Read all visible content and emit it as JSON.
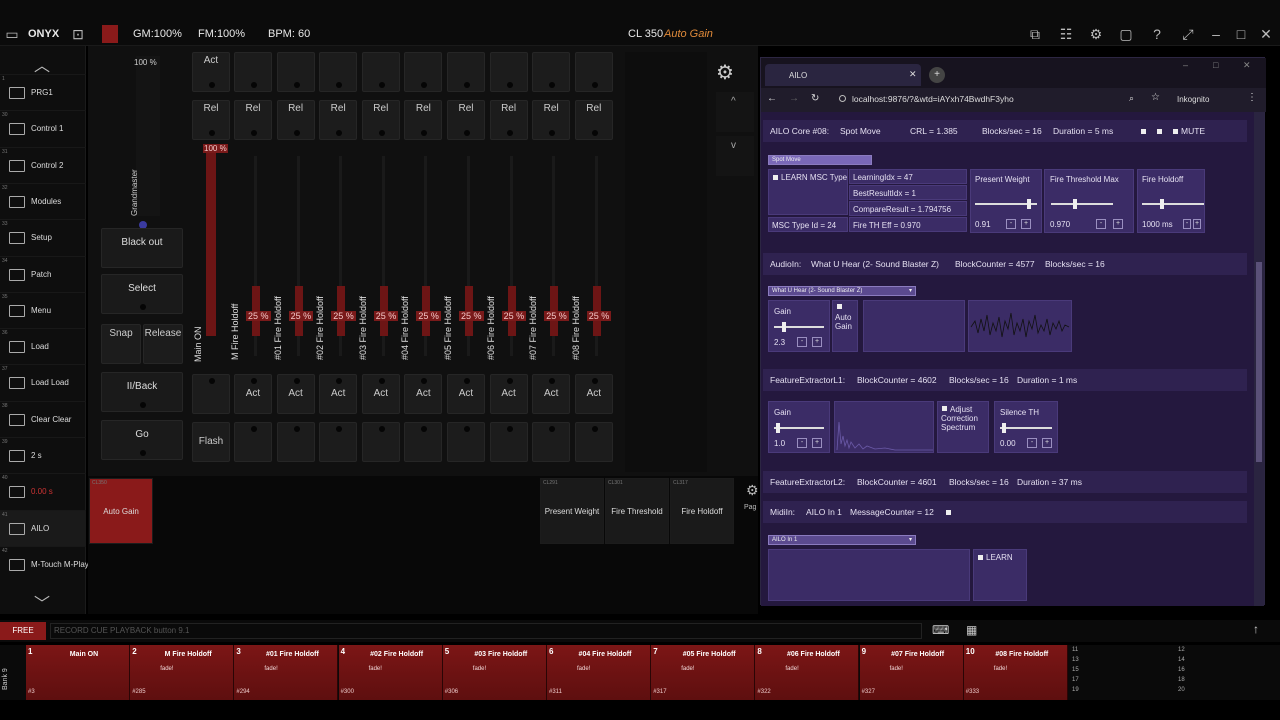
{
  "topbar": {
    "app_name": "ONYX",
    "gm": "GM:100%",
    "fm": "FM:100%",
    "bpm": "BPM: 60",
    "cuelist": "CL 350",
    "cuelist_name": "Auto Gain"
  },
  "sidebar": {
    "items": [
      {
        "num": "1",
        "label": "PRG1"
      },
      {
        "num": "30",
        "label": "Control 1"
      },
      {
        "num": "31",
        "label": "Control 2"
      },
      {
        "num": "32",
        "label": "Modules"
      },
      {
        "num": "33",
        "label": "Setup"
      },
      {
        "num": "34",
        "label": "Patch"
      },
      {
        "num": "35",
        "label": "Menu"
      },
      {
        "num": "36",
        "label": "Load"
      },
      {
        "num": "37",
        "label": "Load Load"
      },
      {
        "num": "38",
        "label": "Clear Clear"
      },
      {
        "num": "39",
        "label": "2 s"
      },
      {
        "num": "40",
        "label": "0.00 s"
      },
      {
        "num": "41",
        "label": "AILO"
      },
      {
        "num": "42",
        "label": "M-Touch M-Play"
      }
    ]
  },
  "master": {
    "grandmaster_label": "Grandmaster",
    "grandmaster_pct": "100 %",
    "main_pct": "100 %",
    "blackout": "Black out",
    "select": "Select",
    "snap": "Snap",
    "release": "Release",
    "pause_back": "II/Back",
    "go": "Go",
    "flash": "Flash",
    "main_on": "Main ON"
  },
  "playbacks": {
    "act": "Act",
    "rel": "Rel",
    "faders": [
      {
        "name": "M Fire Holdoff",
        "pct": "25 %",
        "level": 0.25
      },
      {
        "name": "#01 Fire Holdoff",
        "pct": "25 %",
        "level": 0.25
      },
      {
        "name": "#02 Fire Holdoff",
        "pct": "25 %",
        "level": 0.25
      },
      {
        "name": "#03 Fire Holdoff",
        "pct": "25 %",
        "level": 0.25
      },
      {
        "name": "#04 Fire Holdoff",
        "pct": "25 %",
        "level": 0.25
      },
      {
        "name": "#05 Fire Holdoff",
        "pct": "25 %",
        "level": 0.25
      },
      {
        "name": "#06 Fire Holdoff",
        "pct": "25 %",
        "level": 0.25
      },
      {
        "name": "#07 Fire Holdoff",
        "pct": "25 %",
        "level": 0.25
      },
      {
        "name": "#08 Fire Holdoff",
        "pct": "25 %",
        "level": 0.25
      }
    ]
  },
  "cue_grid": {
    "auto_gain": "Auto Gain",
    "auto_gain_id": "CL350",
    "present_weight": "Present Weight",
    "present_weight_id": "CL291",
    "fire_threshold": "Fire Threshold",
    "fire_threshold_id": "CL301",
    "fire_holdoff": "Fire Holdoff",
    "fire_holdoff_id": "CL317",
    "pct": "100%",
    "gear_label": "Pag"
  },
  "browser": {
    "tab_title": "AILO",
    "url": "localhost:9876/?&wtd=iAYxh74BwdhF3yho",
    "profile": "Inkognito",
    "core": {
      "title": "AILO Core #08:",
      "mode": "Spot Move",
      "crl": "CRL = 1.385",
      "blocks": "Blocks/sec = 16",
      "duration": "Duration = 5 ms",
      "mute": "MUTE",
      "select": "Spot Move",
      "learn_msc": "LEARN MSC Type",
      "learning_idx": "LearningIdx = 47",
      "best_result": "BestResultIdx = 1",
      "compare_result": "CompareResult = 1.794756",
      "msc_type": "MSC Type Id = 24",
      "fire_th_eff": "Fire TH Eff = 0.970",
      "present_weight_label": "Present Weight",
      "present_weight_val": "0.91",
      "fire_th_max_label": "Fire Threshold Max",
      "fire_th_max_val": "0.970",
      "fire_holdoff_label": "Fire Holdoff",
      "fire_holdoff_val": "1000 ms"
    },
    "audio": {
      "title": "AudioIn:",
      "device": "What U Hear (2- Sound Blaster Z)",
      "block_counter": "BlockCounter = 4577",
      "blocks": "Blocks/sec = 16",
      "select": "What U Hear (2- Sound Blaster Z)",
      "gain_label": "Gain",
      "gain_val": "2.3",
      "auto_gain": "Auto Gain"
    },
    "fe1": {
      "title": "FeatureExtractorL1:",
      "block_counter": "BlockCounter = 4602",
      "blocks": "Blocks/sec = 16",
      "duration": "Duration = 1 ms",
      "gain_label": "Gain",
      "gain_val": "1.0",
      "adjust": "Adjust Correction Spectrum",
      "silence_label": "Silence TH",
      "silence_val": "0.00"
    },
    "fe2": {
      "title": "FeatureExtractorL2:",
      "block_counter": "BlockCounter = 4601",
      "blocks": "Blocks/sec = 16",
      "duration": "Duration = 37 ms"
    },
    "midi": {
      "title": "MidiIn:",
      "device": "AILO In 1",
      "message_counter": "MessageCounter = 12",
      "select": "AILO In 1",
      "learn": "LEARN"
    }
  },
  "cmdline": {
    "free": "FREE",
    "placeholder": "RECORD CUE PLAYBACK button 9.1"
  },
  "playback_bar": {
    "bank": "Bank 9",
    "cells": [
      {
        "num": "1",
        "name": "Main ON",
        "sub": "",
        "foot": "#3"
      },
      {
        "num": "2",
        "name": "M Fire Holdoff",
        "sub": "fade!",
        "foot": "#285"
      },
      {
        "num": "3",
        "name": "#01 Fire Holdoff",
        "sub": "fade!",
        "foot": "#294"
      },
      {
        "num": "4",
        "name": "#02 Fire Holdoff",
        "sub": "fade!",
        "foot": "#300"
      },
      {
        "num": "5",
        "name": "#03 Fire Holdoff",
        "sub": "fade!",
        "foot": "#306"
      },
      {
        "num": "6",
        "name": "#04 Fire Holdoff",
        "sub": "fade!",
        "foot": "#311"
      },
      {
        "num": "7",
        "name": "#05 Fire Holdoff",
        "sub": "fade!",
        "foot": "#317"
      },
      {
        "num": "8",
        "name": "#06 Fire Holdoff",
        "sub": "fade!",
        "foot": "#322"
      },
      {
        "num": "9",
        "name": "#07 Fire Holdoff",
        "sub": "fade!",
        "foot": "#327"
      },
      {
        "num": "10",
        "name": "#08 Fire Holdoff",
        "sub": "fade!",
        "foot": "#333"
      }
    ],
    "side_nums": [
      "11",
      "13",
      "15",
      "17",
      "19",
      "12",
      "14",
      "16",
      "18",
      "20"
    ]
  },
  "colors": {
    "accent_red": "#8a1a1a",
    "panel_purple": "#24183e"
  }
}
